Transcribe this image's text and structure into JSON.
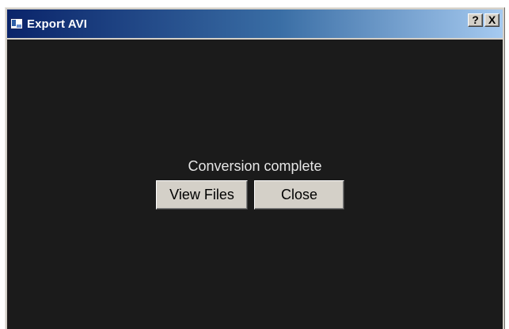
{
  "window": {
    "title": "Export AVI",
    "icon": "app-window-icon",
    "title_buttons": {
      "help_label": "?",
      "close_label": "X"
    }
  },
  "content": {
    "status": "Conversion complete",
    "buttons": {
      "view_files_label": "View Files",
      "close_label": "Close"
    }
  },
  "colors": {
    "titlebar_start": "#0a246a",
    "titlebar_end": "#a6caf0",
    "client_background": "#1b1b1b",
    "button_face": "#d4d0c8",
    "status_text": "#e6e6e6"
  }
}
